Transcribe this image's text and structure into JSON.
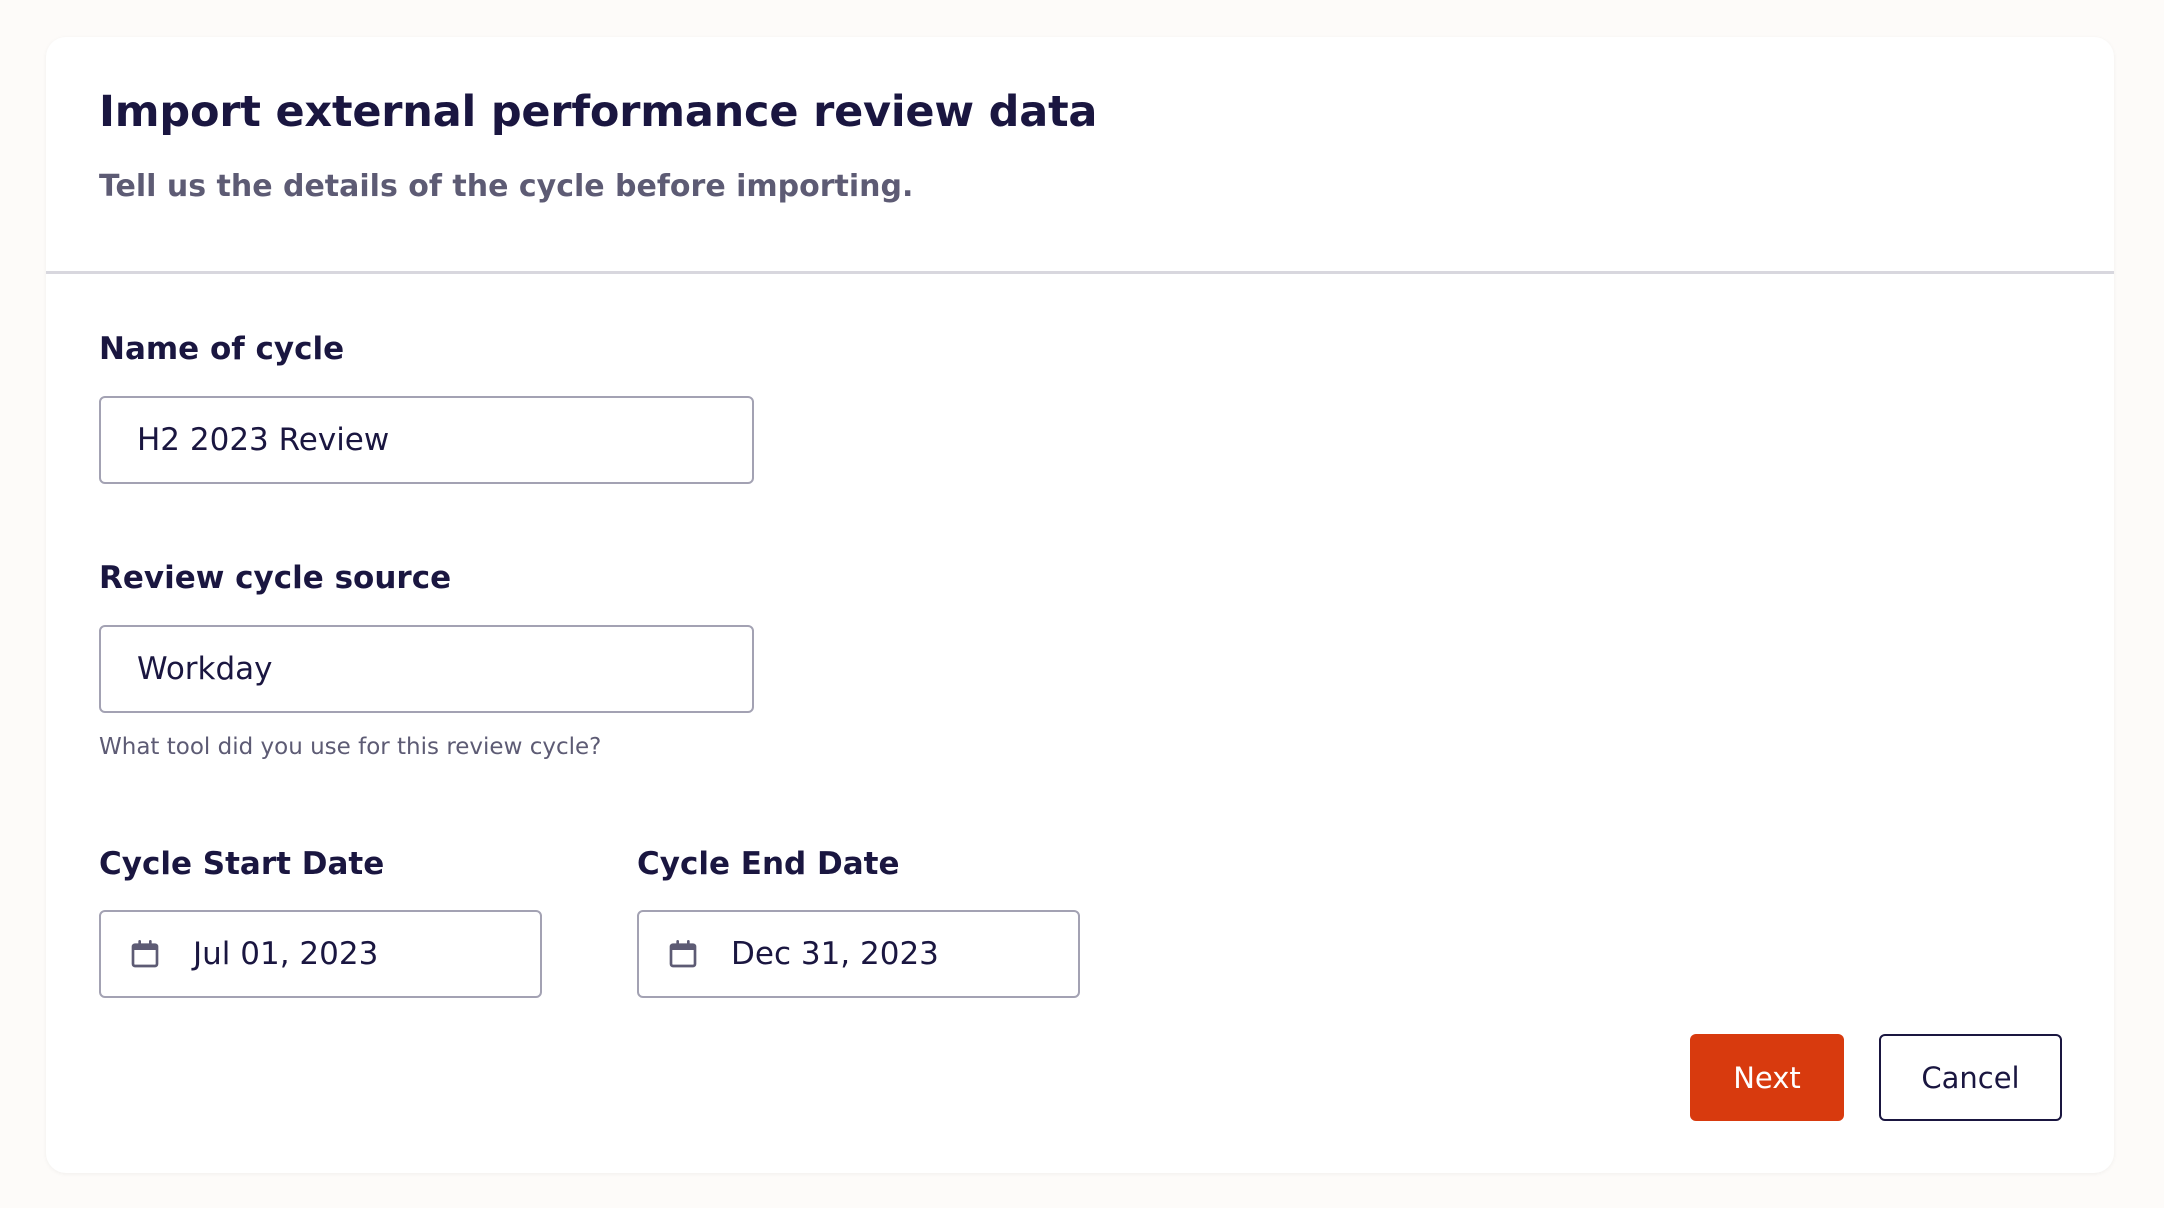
{
  "header": {
    "title": "Import external performance review data",
    "subtitle": "Tell us the details of the cycle before importing."
  },
  "form": {
    "name": {
      "label": "Name of cycle",
      "value": "H2 2023 Review"
    },
    "source": {
      "label": "Review cycle source",
      "value": "Workday",
      "hint": "What tool did you use for this review cycle?"
    },
    "start_date": {
      "label": "Cycle Start Date",
      "value": "Jul 01, 2023",
      "icon": "calendar-icon"
    },
    "end_date": {
      "label": "Cycle End Date",
      "value": "Dec 31, 2023",
      "icon": "calendar-icon"
    }
  },
  "actions": {
    "next_label": "Next",
    "cancel_label": "Cancel"
  },
  "colors": {
    "primary": "#d83a0e",
    "text": "#1a1640",
    "muted": "#5d5b74",
    "border": "#a3a2b3"
  }
}
